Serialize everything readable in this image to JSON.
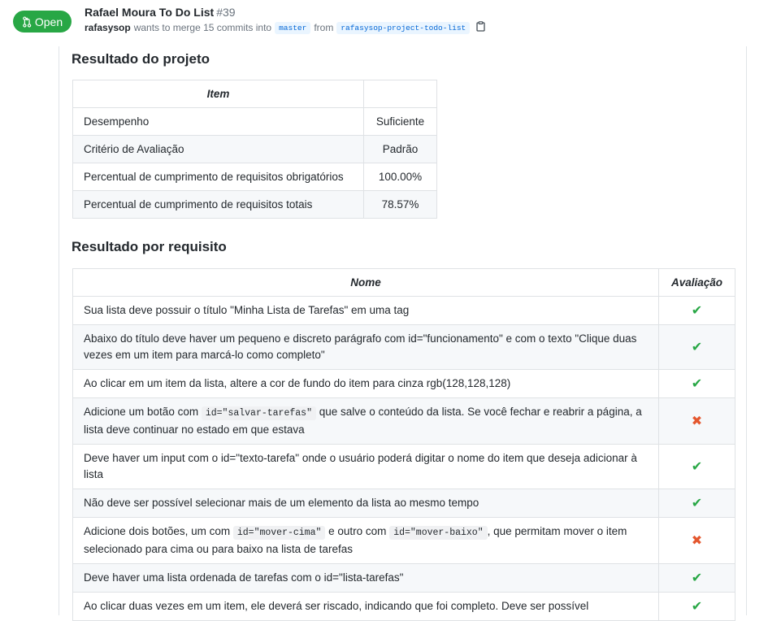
{
  "header": {
    "state": "Open",
    "title": "Rafael Moura To Do List",
    "number": "#39",
    "author": "rafasysop",
    "merge_text": "wants to merge 15 commits into",
    "base_branch": "master",
    "from_text": "from",
    "head_branch": "rafasysop-project-todo-list"
  },
  "project_result": {
    "heading": "Resultado do projeto",
    "col_item": "Item",
    "col_value": "",
    "rows": [
      {
        "item": "Desempenho",
        "value": "Suficiente"
      },
      {
        "item": "Critério de Avaliação",
        "value": "Padrão"
      },
      {
        "item": "Percentual de cumprimento de requisitos obrigatórios",
        "value": "100.00%"
      },
      {
        "item": "Percentual de cumprimento de requisitos totais",
        "value": "78.57%"
      }
    ]
  },
  "requirements": {
    "heading": "Resultado por requisito",
    "col_name": "Nome",
    "col_eval": "Avaliação",
    "rows": [
      {
        "parts": [
          "Sua lista deve possuir o título \"Minha Lista de Tarefas\" em uma tag"
        ],
        "mark": "✔",
        "status": "ok"
      },
      {
        "parts": [
          "Abaixo do título deve haver um pequeno e discreto parágrafo com id=\"funcionamento\" e com o texto \"Clique duas vezes em um item para marcá-lo como completo\""
        ],
        "mark": "✔",
        "status": "ok"
      },
      {
        "parts": [
          "Ao clicar em um item da lista, altere a cor de fundo do item para cinza rgb(128,128,128)"
        ],
        "mark": "✔",
        "status": "ok"
      },
      {
        "parts": [
          "Adicione um botão com ",
          "id=\"salvar-tarefas\"",
          " que salve o conteúdo da lista. Se você fechar e reabrir a página, a lista deve continuar no estado em que estava"
        ],
        "mark": "✖",
        "status": "fail"
      },
      {
        "parts": [
          "Deve haver um input com o id=\"texto-tarefa\" onde o usuário poderá digitar o nome do item que deseja adicionar à lista"
        ],
        "mark": "✔",
        "status": "ok"
      },
      {
        "parts": [
          "Não deve ser possível selecionar mais de um elemento da lista ao mesmo tempo"
        ],
        "mark": "✔",
        "status": "ok"
      },
      {
        "parts": [
          "Adicione dois botões, um com ",
          "id=\"mover-cima\"",
          " e outro com ",
          "id=\"mover-baixo\"",
          ", que permitam mover o item selecionado para cima ou para baixo na lista de tarefas"
        ],
        "mark": "✖",
        "status": "fail"
      },
      {
        "parts": [
          "Deve haver uma lista ordenada de tarefas com o id=\"lista-tarefas\""
        ],
        "mark": "✔",
        "status": "ok"
      },
      {
        "parts": [
          "Ao clicar duas vezes em um item, ele deverá ser riscado, indicando que foi completo. Deve ser possível"
        ],
        "mark": "✔",
        "status": "ok"
      }
    ]
  },
  "colors": {
    "open_badge": "#28a745",
    "check": "#28a745",
    "cross": "#e4572e",
    "branch_bg": "#eaf5ff",
    "branch_text": "#0366d6"
  },
  "icons": {
    "state": "git-pull-request-icon",
    "copy": "clipboard-icon",
    "ok": "check-icon",
    "fail": "x-icon"
  }
}
